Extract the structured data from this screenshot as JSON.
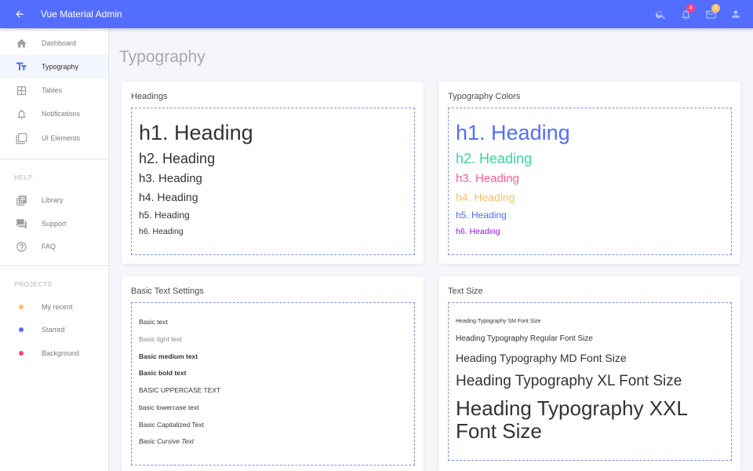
{
  "app": {
    "title": "Vue Material Admin"
  },
  "header": {
    "notifications_badge": "4",
    "messages_badge": "3",
    "colors": {
      "bar": "#536dfe",
      "notifications_badge": "#ff4081",
      "messages_badge": "#ffc260"
    }
  },
  "sidebar": {
    "items": [
      {
        "label": "Dashboard",
        "icon": "home-icon"
      },
      {
        "label": "Typography",
        "icon": "typography-icon",
        "active": true
      },
      {
        "label": "Tables",
        "icon": "table-icon"
      },
      {
        "label": "Notifications",
        "icon": "bell-icon"
      },
      {
        "label": "UI Elements",
        "icon": "layers-icon"
      }
    ],
    "help": {
      "title": "HELP",
      "items": [
        {
          "label": "Library",
          "icon": "library-icon"
        },
        {
          "label": "Support",
          "icon": "forum-icon"
        },
        {
          "label": "FAQ",
          "icon": "help-circle-icon"
        }
      ]
    },
    "projects": {
      "title": "PROJECTS",
      "items": [
        {
          "label": "My recent",
          "color": "#ffc260"
        },
        {
          "label": "Starred",
          "color": "#536dfe"
        },
        {
          "label": "Background",
          "color": "#ff4081"
        }
      ]
    }
  },
  "page": {
    "title": "Typography"
  },
  "cards": {
    "headings": {
      "title": "Headings",
      "h1": "h1. Heading",
      "h2": "h2. Heading",
      "h3": "h3. Heading",
      "h4": "h4. Heading",
      "h5": "h5. Heading",
      "h6": "h6. Heading"
    },
    "colors": {
      "title": "Typography Colors",
      "h1": "h1. Heading",
      "h2": "h2. Heading",
      "h3": "h3. Heading",
      "h4": "h4. Heading",
      "h5": "h5. Heading",
      "h6": "h6. Heading",
      "palette": {
        "h1": "#536dfe",
        "h2": "#3cd4a0",
        "h3": "#ff5c93",
        "h4": "#ffc260",
        "h5": "#536dfe",
        "h6": "#9013fe"
      }
    },
    "basic": {
      "title": "Basic Text Settings",
      "basic": "Basic text",
      "light": "Basic light text",
      "medium": "Basic medium text",
      "bold": "Basic bold text",
      "uppercase": "BASIC UPPERCASE TEXT",
      "lowercase": "basic lowercase text",
      "capitalized": "Basic Capitalized Text",
      "cursive": "Basic Cursive Text"
    },
    "size": {
      "title": "Text Size",
      "sm": "Heading Typography SM Font Size",
      "regular": "Heading Typography Regular Font Size",
      "md": "Heading Typography MD Font Size",
      "xl": "Heading Typography XL Font Size",
      "xxl_line1": "Heading Typography XXL",
      "xxl_line2": "Font Size"
    }
  }
}
